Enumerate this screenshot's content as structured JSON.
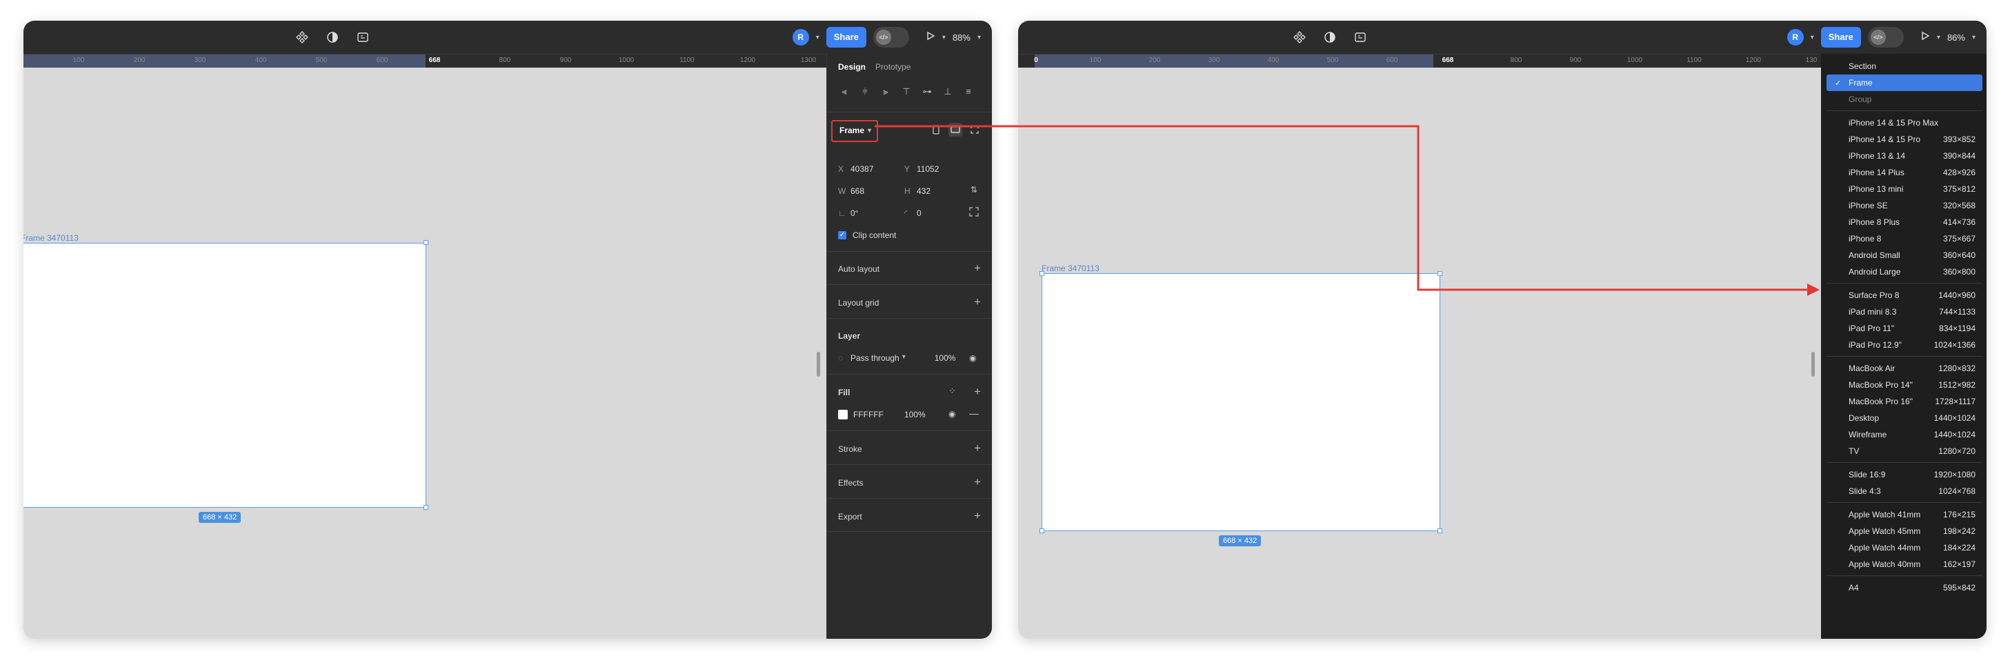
{
  "toolbar": {
    "avatar_initial": "R",
    "share_label": "Share",
    "dev_toggle_label": "</>",
    "zoom_left": "88%",
    "zoom_right": "86%"
  },
  "left": {
    "ruler_ticks": [
      "100",
      "200",
      "300",
      "400",
      "500",
      "600",
      "668",
      "800",
      "900",
      "1000",
      "1100",
      "1200",
      "1300"
    ],
    "frame_label": "Frame 3470113",
    "frame_dims": "668 × 432",
    "tabs": {
      "design": "Design",
      "prototype": "Prototype"
    },
    "frame_dropdown": "Frame",
    "x_label": "X",
    "x_value": "40387",
    "y_label": "Y",
    "y_value": "11052",
    "w_label": "W",
    "w_value": "668",
    "h_label": "H",
    "h_value": "432",
    "rotation": "0°",
    "radius": "0",
    "clip_content": "Clip content",
    "auto_layout": "Auto layout",
    "layout_grid": "Layout grid",
    "layer": "Layer",
    "blend_mode": "Pass through",
    "layer_opacity": "100%",
    "fill": "Fill",
    "fill_hex": "FFFFFF",
    "fill_opacity": "100%",
    "stroke": "Stroke",
    "effects": "Effects",
    "export": "Export"
  },
  "right": {
    "ruler_ticks": [
      "0",
      "100",
      "200",
      "300",
      "400",
      "500",
      "600",
      "668",
      "800",
      "900",
      "1000",
      "1100",
      "1200",
      "130"
    ],
    "frame_label": "Frame 3470113",
    "frame_dims": "668 × 432",
    "menu": [
      {
        "label": "Section",
        "size": "",
        "state": "header"
      },
      {
        "label": "Frame",
        "size": "",
        "state": "selected"
      },
      {
        "label": "Group",
        "size": "",
        "state": "dim"
      },
      {
        "label": "iPhone 14 & 15 Pro Max",
        "size": "",
        "group": 1
      },
      {
        "label": "iPhone 14 & 15 Pro",
        "size": "393×852"
      },
      {
        "label": "iPhone 13 & 14",
        "size": "390×844"
      },
      {
        "label": "iPhone 14 Plus",
        "size": "428×926"
      },
      {
        "label": "iPhone 13 mini",
        "size": "375×812"
      },
      {
        "label": "iPhone SE",
        "size": "320×568"
      },
      {
        "label": "iPhone 8 Plus",
        "size": "414×736"
      },
      {
        "label": "iPhone 8",
        "size": "375×667"
      },
      {
        "label": "Android Small",
        "size": "360×640"
      },
      {
        "label": "Android Large",
        "size": "360×800"
      },
      {
        "label": "Surface Pro 8",
        "size": "1440×960",
        "group": 2
      },
      {
        "label": "iPad mini 8.3",
        "size": "744×1133"
      },
      {
        "label": "iPad Pro 11\"",
        "size": "834×1194"
      },
      {
        "label": "iPad Pro 12.9\"",
        "size": "1024×1366"
      },
      {
        "label": "MacBook Air",
        "size": "1280×832",
        "group": 3
      },
      {
        "label": "MacBook Pro 14\"",
        "size": "1512×982"
      },
      {
        "label": "MacBook Pro 16\"",
        "size": "1728×1117"
      },
      {
        "label": "Desktop",
        "size": "1440×1024"
      },
      {
        "label": "Wireframe",
        "size": "1440×1024"
      },
      {
        "label": "TV",
        "size": "1280×720"
      },
      {
        "label": "Slide 16:9",
        "size": "1920×1080",
        "group": 4
      },
      {
        "label": "Slide 4:3",
        "size": "1024×768"
      },
      {
        "label": "Apple Watch 41mm",
        "size": "176×215",
        "group": 5
      },
      {
        "label": "Apple Watch 45mm",
        "size": "198×242"
      },
      {
        "label": "Apple Watch 44mm",
        "size": "184×224"
      },
      {
        "label": "Apple Watch 40mm",
        "size": "162×197"
      },
      {
        "label": "A4",
        "size": "595×842",
        "group": 6
      }
    ]
  },
  "colors": {
    "accent": "#3b82f6",
    "callout": "#e53935",
    "selection": "#5b9bf0"
  }
}
